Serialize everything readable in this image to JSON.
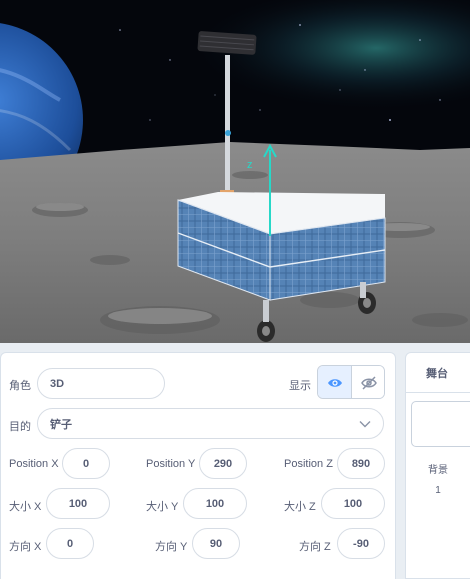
{
  "sprite": {
    "role_label": "角色",
    "role_name": "3D",
    "show_label": "显示",
    "show_icon": "eye-icon",
    "hide_icon": "eye-slash-icon",
    "target_label": "目的",
    "target_value": "铲子",
    "target_icon": "chevron-down-icon",
    "position_x_label": "Position X",
    "position_x": "0",
    "position_y_label": "Position Y",
    "position_y": "290",
    "position_z_label": "Position Z",
    "position_z": "890",
    "size_x_label": "大小 X",
    "size_x": "100",
    "size_y_label": "大小 Y",
    "size_y": "100",
    "size_z_label": "大小 Z",
    "size_z": "100",
    "dir_x_label": "方向 X",
    "dir_x": "0",
    "dir_y_label": "方向 Y",
    "dir_y": "90",
    "dir_z_label": "方向 Z",
    "dir_z": "-90"
  },
  "stage_panel": {
    "title": "舞台",
    "backdrop_label": "背景",
    "backdrop_count": "1"
  },
  "scene": {
    "axis_label": "z"
  },
  "colors": {
    "accent": "#4c97ff",
    "gizmo": "#27d8c8",
    "panel_border": "#d9e1ea",
    "text": "#575e75"
  }
}
